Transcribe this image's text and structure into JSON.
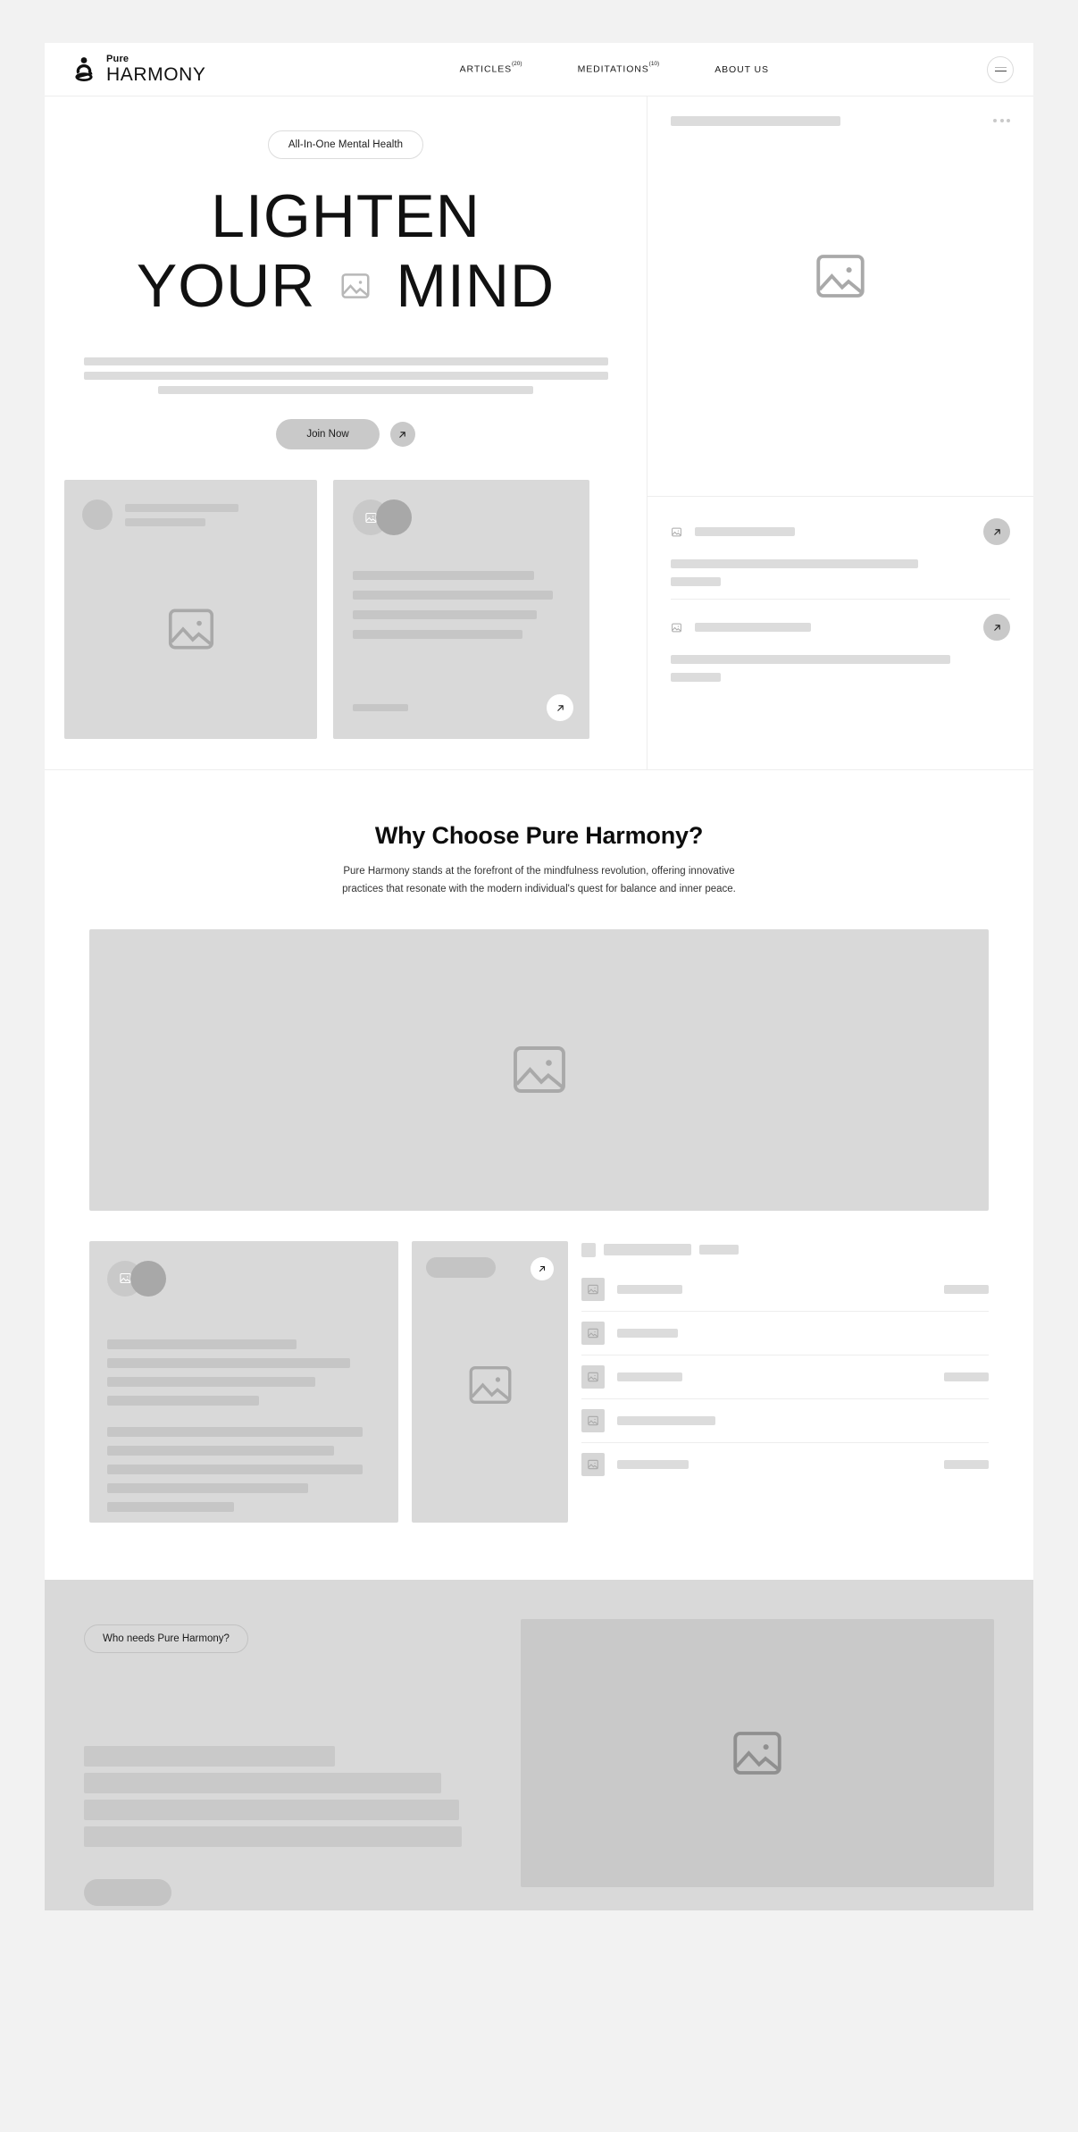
{
  "brand": {
    "name_top": "Pure",
    "name_bottom": "HARMONY",
    "logo_icon": "meditation-figure-icon"
  },
  "nav": {
    "items": [
      {
        "label": "ARTICLES",
        "count": "(20)"
      },
      {
        "label": "MEDITATIONS",
        "count": "(10)"
      },
      {
        "label": "ABOUT US",
        "count": ""
      }
    ],
    "menu_icon": "hamburger-menu-icon"
  },
  "hero": {
    "badge": "All-In-One Mental Health",
    "headline_line1": "LIGHTEN",
    "headline_line2_a": "YOUR",
    "headline_line2_b": "MIND",
    "headline_image_icon": "image-placeholder-icon",
    "cta_label": "Join Now",
    "cta_arrow_icon": "arrow-up-right-icon",
    "panel_menu_icon": "more-options-icon",
    "card_arrow_icon": "arrow-up-right-icon",
    "list_arrow_icon": "arrow-up-right-icon"
  },
  "why": {
    "title": "Why Choose Pure Harmony?",
    "description": "Pure Harmony stands at the forefront of the mindfulness revolution, offering innovative practices that resonate with the modern individual's quest for balance and inner peace.",
    "hero_image_icon": "image-placeholder-icon",
    "panel_arrow_icon": "arrow-up-right-icon"
  },
  "who": {
    "badge": "Who needs Pure Harmony?",
    "image_icon": "image-placeholder-icon"
  },
  "colors": {
    "page_bg": "#f2f2f2",
    "surface": "#ffffff",
    "skeleton": "#dcdcdc",
    "card": "#d9d9d9",
    "accent_dark": "#111111"
  }
}
